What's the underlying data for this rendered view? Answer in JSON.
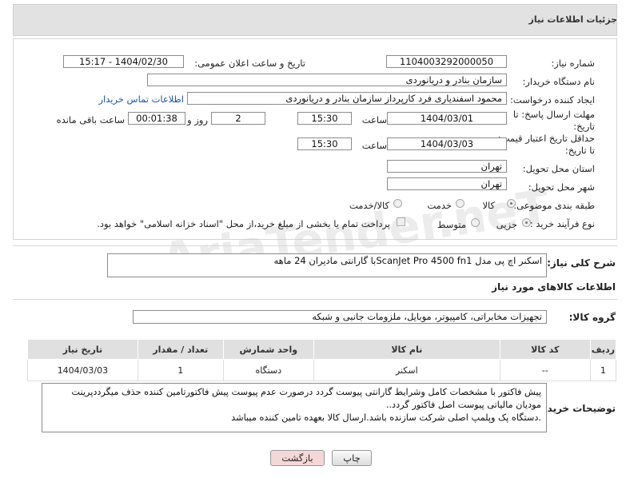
{
  "header": {
    "title": "جزئیات اطلاعات نیاز"
  },
  "labels": {
    "need_number": "شماره نیاز:",
    "announce_datetime": "تاریخ و ساعت اعلان عمومی:",
    "buyer_org": "نام دستگاه خریدار:",
    "requester": "ایجاد کننده درخواست:",
    "contact_link": "اطلاعات تماس خریدار",
    "reply_deadline": "مهلت ارسال پاسخ: تا تاریخ:",
    "time_word": "ساعت",
    "day_and": "روز و",
    "remaining": "ساعت باقی مانده",
    "price_validity": "حداقل تاریخ اعتبار قیمت: تا تاریخ:",
    "delivery_province": "استان محل تحویل:",
    "delivery_city": "شهر محل تحویل:",
    "category": "طبقه بندی موضوعی:",
    "process_type": "نوع فرآیند خرید :",
    "general_desc": "شرح کلی نیاز:",
    "goods_info": "اطلاعات کالاهای مورد نیاز",
    "goods_group": "گروه کالا:",
    "buyer_notes": "توضیحات خریدار:"
  },
  "fields": {
    "need_number": "1104003292000050",
    "announce_datetime": "1404/02/30 - 15:17",
    "buyer_org": "سازمان بنادر و دریانوردی",
    "requester": "محمود اسفندیاری فرد کارپرداز سازمان بنادر و دریانوردی",
    "reply_date": "1404/03/01",
    "reply_time": "15:30",
    "reply_days": "2",
    "remaining_time": "00:01:38",
    "validity_date": "1404/03/03",
    "validity_time": "15:30",
    "province": "تهران",
    "city": "تهران",
    "general_desc": "اسکنر اچ پی مدل ScanJet Pro 4500 fn1با گارانتی مادیران 24 ماهه",
    "goods_group": "تجهیزات مخابراتی، کامپیوتر، موبایل، ملزومات جانبی و شبکه",
    "buyer_notes_1": "پیش فاکتور با مشخصات کامل وشرایط گارانتی پیوست گردد درصورت عدم پیوست پیش فاکتورتامین کننده حذف میگرددپرینت",
    "buyer_notes_2": "مودیان مالیاتی پیوست اصل فاکتور گردد..",
    "buyer_notes_3": ".دستگاه پک وپلمپ اصلی شرکت سازنده باشد.ارسال کالا بعهده تامین کننده میباشد"
  },
  "category_options": [
    {
      "label": "کالا",
      "selected": true
    },
    {
      "label": "خدمت",
      "selected": false
    },
    {
      "label": "کالا/خدمت",
      "selected": false
    }
  ],
  "process_options": [
    {
      "label": "جزیی",
      "selected": true
    },
    {
      "label": "متوسط",
      "selected": false
    }
  ],
  "payment_note": "پرداخت تمام یا بخشی از مبلغ خرید،از محل \"اسناد خزانه اسلامی\" خواهد بود.",
  "table": {
    "headers": [
      "ردیف",
      "کد کالا",
      "نام کالا",
      "واحد شمارش",
      "تعداد / مقدار",
      "تاریخ نیاز"
    ],
    "rows": [
      [
        "1",
        "--",
        "اسکنر",
        "دستگاه",
        "1",
        "1404/03/03"
      ]
    ]
  },
  "buttons": {
    "print": "چاپ",
    "back": "بازگشت"
  },
  "watermark": "AriaTender.neT",
  "colors": {
    "link": "#1a56b8",
    "back_button_bg": "#f6d7d7"
  }
}
